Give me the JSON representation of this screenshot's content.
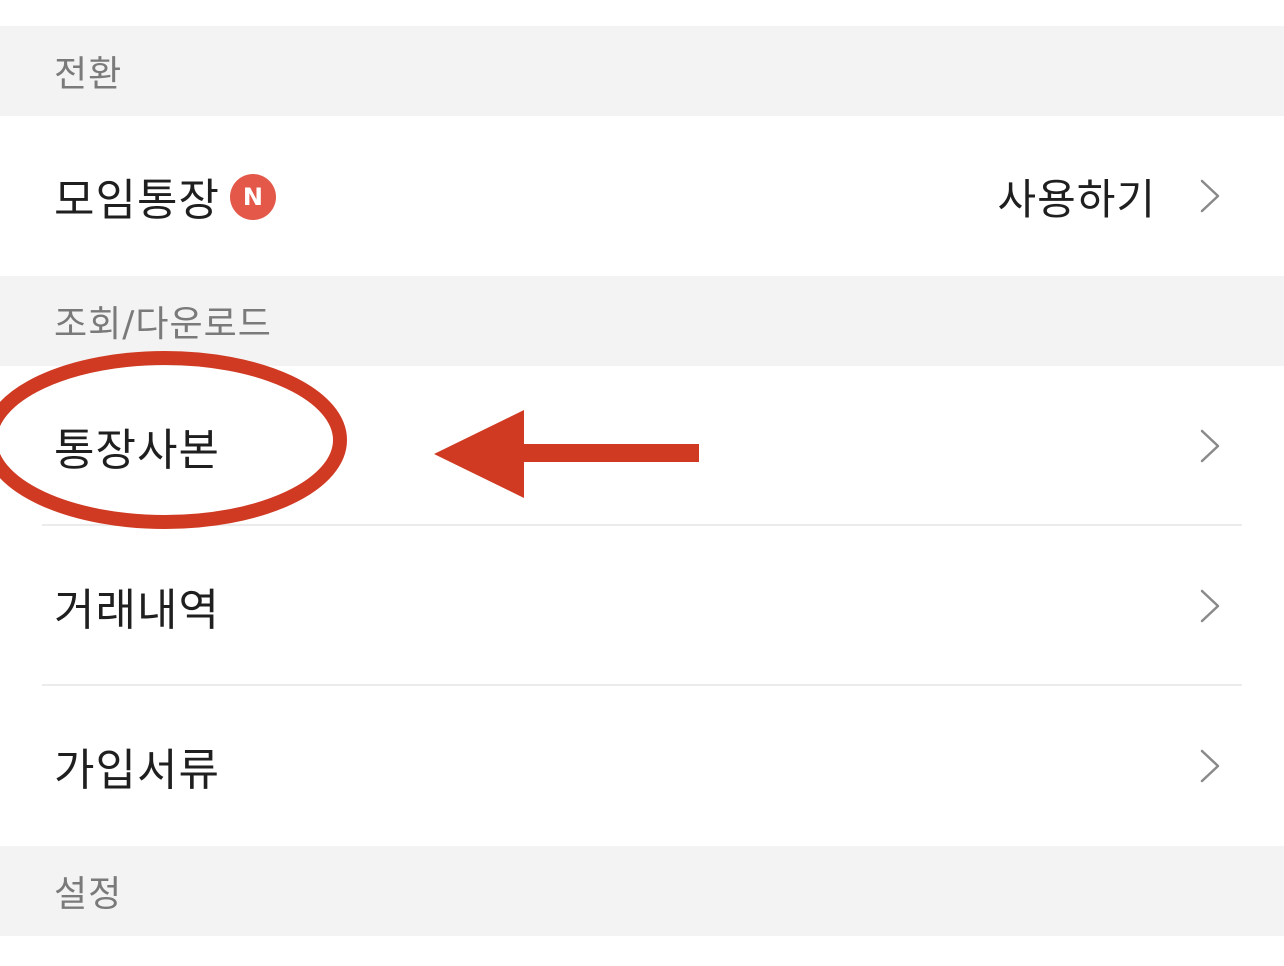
{
  "sections": [
    {
      "header": "전환",
      "items": [
        {
          "label": "모임통장",
          "badge": "N",
          "value": "사용하기"
        }
      ]
    },
    {
      "header": "조회/다운로드",
      "items": [
        {
          "label": "통장사본"
        },
        {
          "label": "거래내역"
        },
        {
          "label": "가입서류"
        }
      ]
    },
    {
      "header": "설정",
      "items": []
    }
  ],
  "colors": {
    "badge": "#e4584a",
    "annotation": "#d03a22",
    "section_bg": "#f3f3f3"
  },
  "icons": {
    "chevron": "chevron-right-icon"
  }
}
